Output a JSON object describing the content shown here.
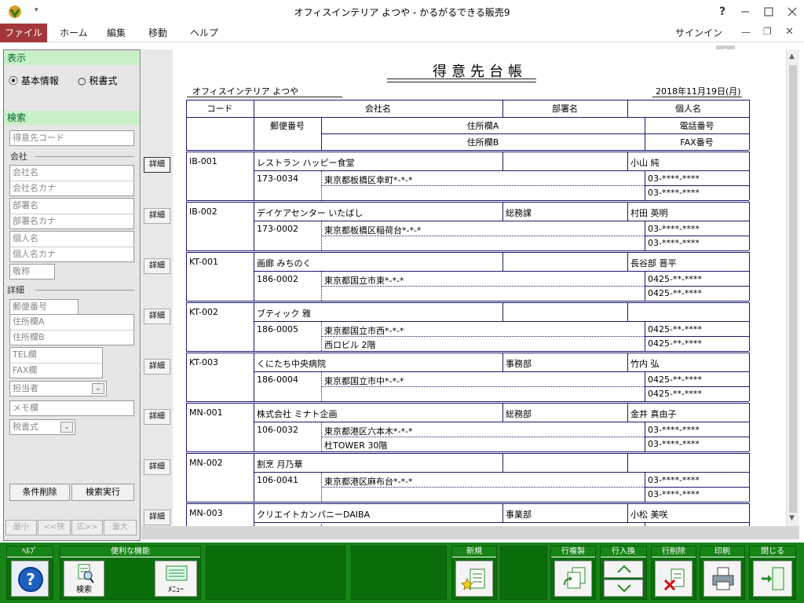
{
  "window": {
    "title": "オフィスインテリア よつや - かるがるできる販売9",
    "help": "?",
    "signin": "サインイン"
  },
  "ribbon": {
    "tabs": [
      "ファイル",
      "ホーム",
      "編集",
      "移動",
      "ヘルプ"
    ]
  },
  "left_panel": {
    "display_header": "表示",
    "radio_basic": "基本情報",
    "radio_tax": "税書式",
    "search_header": "検索",
    "customer_code": "得意先コード",
    "company_group": "会社",
    "company_name": "会社名",
    "company_kana": "会社名カナ",
    "dept_name": "部署名",
    "dept_kana": "部署名カナ",
    "person_name": "個人名",
    "person_kana": "個人名カナ",
    "honorific": "敬称",
    "detail_group": "詳細",
    "postal": "郵便番号",
    "address_a": "住所欄A",
    "address_b": "住所欄B",
    "tel": "TEL欄",
    "fax": "FAX欄",
    "staff": "担当者",
    "memo": "メモ欄",
    "tax_format": "税書式",
    "clear_btn": "条件削除",
    "search_btn": "検索実行",
    "nav": [
      "最小",
      "<<狭",
      "広>>",
      "最大"
    ]
  },
  "report": {
    "title": "得意先台帳",
    "company": "オフィスインテリア よつや",
    "date": "2018年11月19日(月)",
    "headers": {
      "code": "コード",
      "company": "会社名",
      "dept": "部署名",
      "person": "個人名",
      "postal": "郵便番号",
      "address_a": "住所欄A",
      "address_b": "住所欄B",
      "phone": "電話番号",
      "fax": "FAX番号"
    },
    "detail_label": "詳細",
    "rows": [
      {
        "code": "IB-001",
        "company": "レストラン ハッピー食堂",
        "dept": "",
        "person": "小山 純",
        "postal": "173-0034",
        "addr_a": "東京都板橋区幸町*-*-*",
        "addr_b": "",
        "tel": "03-****-****",
        "fax": "03-****-****"
      },
      {
        "code": "IB-002",
        "company": "デイケアセンター いたばし",
        "dept": "総務課",
        "person": "村田 英明",
        "postal": "173-0002",
        "addr_a": "東京都板橋区稲荷台*-*-*",
        "addr_b": "",
        "tel": "03-****-****",
        "fax": "03-****-****"
      },
      {
        "code": "KT-001",
        "company": "画廊 みちのく",
        "dept": "",
        "person": "長谷部 晋平",
        "postal": "186-0002",
        "addr_a": "東京都国立市東*-*-*",
        "addr_b": "",
        "tel": "0425-**-****",
        "fax": "0425-**-****"
      },
      {
        "code": "KT-002",
        "company": "ブティック 雅",
        "dept": "",
        "person": "",
        "postal": "186-0005",
        "addr_a": "東京都国立市西*-*-*",
        "addr_b": "西ロビル 2階",
        "tel": "0425-**-****",
        "fax": "0425-**-****"
      },
      {
        "code": "KT-003",
        "company": "くにたち中央病院",
        "dept": "事務部",
        "person": "竹内 弘",
        "postal": "186-0004",
        "addr_a": "東京都国立市中*-*-*",
        "addr_b": "",
        "tel": "0425-**-****",
        "fax": "0425-**-****"
      },
      {
        "code": "MN-001",
        "company": "株式会社 ミナト企画",
        "dept": "総務部",
        "person": "金井 真由子",
        "postal": "106-0032",
        "addr_a": "東京都港区六本木*-*-*",
        "addr_b": "杜TOWER 30階",
        "tel": "03-****-****",
        "fax": "03-****-****"
      },
      {
        "code": "MN-002",
        "company": "割烹 月乃華",
        "dept": "",
        "person": "",
        "postal": "106-0041",
        "addr_a": "東京都港区麻布台*-*-*",
        "addr_b": "",
        "tel": "03-****-****",
        "fax": "03-****-****"
      },
      {
        "code": "MN-003",
        "company": "クリエイトカンパニーDAIBA",
        "dept": "事業部",
        "person": "小松 美咲",
        "postal": "",
        "addr_a": "",
        "addr_b": "",
        "tel": "",
        "fax": ""
      }
    ]
  },
  "footer": {
    "help": "ﾍﾙﾌﾟ",
    "convenience": "便利な機能",
    "search": "検索",
    "menu": "ﾒﾆｭｰ",
    "new": "新規",
    "row_copy": "行複製",
    "row_swap": "行入換",
    "row_delete": "行削除",
    "print": "印刷",
    "close": "閉じる"
  },
  "colors": {
    "file_tab": "#a4373a",
    "footer_green": "#178417",
    "section_green": "#c8f0c8",
    "table_line": "#1a1a6e"
  }
}
